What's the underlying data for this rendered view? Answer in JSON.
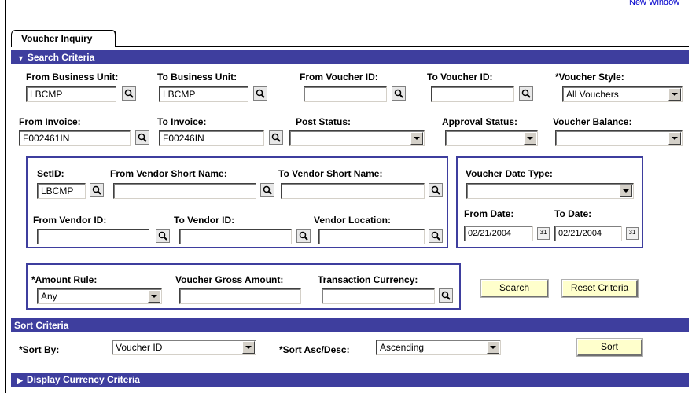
{
  "header": {
    "new_window_link": "New Window"
  },
  "tabs": [
    {
      "label": "Voucher Inquiry"
    }
  ],
  "search_criteria": {
    "title": "Search Criteria",
    "from_business_unit": {
      "label": "From Business Unit:",
      "value": "LBCMP"
    },
    "to_business_unit": {
      "label": "To Business Unit:",
      "value": "LBCMP"
    },
    "from_voucher_id": {
      "label": "From Voucher ID:",
      "value": ""
    },
    "to_voucher_id": {
      "label": "To Voucher ID:",
      "value": ""
    },
    "voucher_style": {
      "label": "*Voucher Style:",
      "value": "All Vouchers"
    },
    "from_invoice": {
      "label": "From Invoice:",
      "value": "F002461IN"
    },
    "to_invoice": {
      "label": "To Invoice:",
      "value": "F00246IN"
    },
    "post_status": {
      "label": "Post Status:",
      "value": ""
    },
    "approval_status": {
      "label": "Approval Status:",
      "value": ""
    },
    "voucher_balance": {
      "label": "Voucher Balance:",
      "value": ""
    },
    "vendor": {
      "setid": {
        "label": "SetID:",
        "value": "LBCMP"
      },
      "from_vendor_short_name": {
        "label": "From Vendor Short Name:",
        "value": ""
      },
      "to_vendor_short_name": {
        "label": "To Vendor Short Name:",
        "value": ""
      },
      "from_vendor_id": {
        "label": "From Vendor ID:",
        "value": ""
      },
      "to_vendor_id": {
        "label": "To Vendor ID:",
        "value": ""
      },
      "vendor_location": {
        "label": "Vendor Location:",
        "value": ""
      }
    },
    "dates": {
      "voucher_date_type": {
        "label": "Voucher Date Type:",
        "value": ""
      },
      "from_date": {
        "label": "From Date:",
        "value": "02/21/2004"
      },
      "to_date": {
        "label": "To Date:",
        "value": "02/21/2004"
      },
      "calendar_glyph": "31"
    },
    "amount": {
      "amount_rule": {
        "label": "*Amount Rule:",
        "value": "Any"
      },
      "voucher_gross_amount": {
        "label": "Voucher Gross Amount:",
        "value": ""
      },
      "transaction_currency": {
        "label": "Transaction Currency:",
        "value": ""
      }
    },
    "search_button": "Search",
    "reset_button": "Reset Criteria"
  },
  "sort_criteria": {
    "title": "Sort Criteria",
    "sort_by": {
      "label": "*Sort By:",
      "value": "Voucher ID"
    },
    "sort_order": {
      "label": "*Sort Asc/Desc:",
      "value": "Ascending"
    },
    "sort_button": "Sort"
  },
  "display_currency": {
    "title": "Display Currency Criteria"
  },
  "icons": {
    "lookup": "magnifier-icon",
    "calendar": "calendar-icon",
    "expanded": "triangle-down-icon",
    "collapsed": "triangle-right-icon"
  },
  "colors": {
    "band": "#3e3e9e",
    "button_bg": "#ffffcc"
  }
}
